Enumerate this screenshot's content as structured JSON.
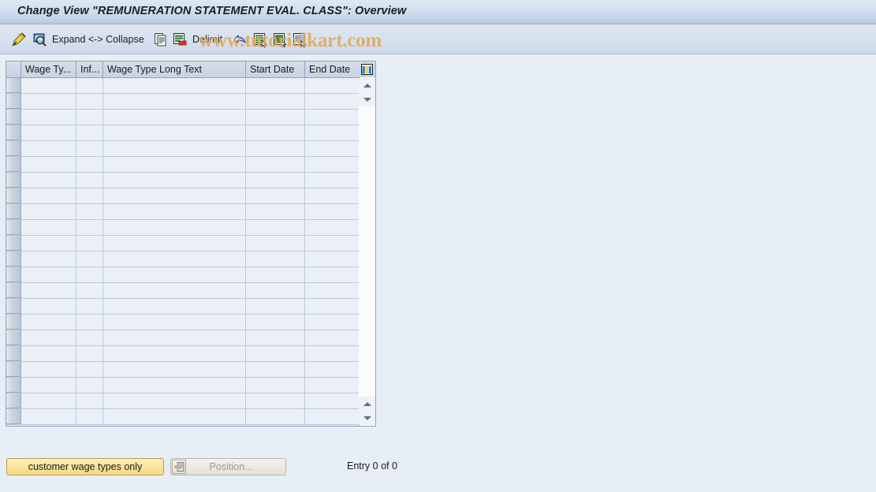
{
  "window": {
    "title": "Change View \"REMUNERATION STATEMENT EVAL. CLASS\": Overview"
  },
  "toolbar": {
    "items": [
      {
        "name": "change-display-icon",
        "label": "",
        "icon": "pencil-ruler-icon"
      },
      {
        "name": "display-detail-icon",
        "label": "",
        "icon": "magnifier-screen-icon"
      },
      {
        "name": "expand-collapse-button",
        "label": "Expand <-> Collapse",
        "icon": ""
      },
      {
        "name": "copy-as-icon",
        "label": "",
        "icon": "copy-pages-icon"
      },
      {
        "name": "delete-icon",
        "label": "",
        "icon": "delete-row-icon"
      },
      {
        "name": "delimit-button",
        "label": "Delimit",
        "icon": ""
      },
      {
        "name": "undo-icon",
        "label": "",
        "icon": "undo-arrow-icon"
      },
      {
        "name": "select-all-icon",
        "label": "",
        "icon": "select-all-icon"
      },
      {
        "name": "deselect-all-icon",
        "label": "",
        "icon": "deselect-all-icon"
      },
      {
        "name": "select-block-icon",
        "label": "",
        "icon": "select-block-icon"
      }
    ]
  },
  "watermark": {
    "text": "www.tutorialkart.com",
    "color": "#e3a858"
  },
  "table": {
    "columns": [
      {
        "id": "wage_type",
        "label": "Wage Ty...",
        "width": 70
      },
      {
        "id": "infotype",
        "label": "Inf...",
        "width": 34
      },
      {
        "id": "long_text",
        "label": "Wage Type Long Text",
        "width": 181
      },
      {
        "id": "start_date",
        "label": "Start Date",
        "width": 75
      },
      {
        "id": "end_date",
        "label": "End Date",
        "width": 70
      }
    ],
    "rows": [],
    "empty_row_count": 22,
    "column_config_icon": "column-settings-icon"
  },
  "scrollbar": {
    "up_icon": "scroll-up-arrow-icon",
    "down_icon": "scroll-down-arrow-icon"
  },
  "footer": {
    "customer_wage_types_label": "customer wage types only",
    "position_label": "Position...",
    "position_icon": "position-goto-icon",
    "entry_count": "Entry 0 of 0"
  },
  "colors": {
    "title_bar": "#c3d3e6",
    "toolbar": "#d7e2ef",
    "page_bg": "#e8eef5",
    "grid_border": "#8ba4c2",
    "grid_cell_bg": "#ebf0f7",
    "accent_yellow": "#f6d97f",
    "watermark": "#e3a858"
  }
}
